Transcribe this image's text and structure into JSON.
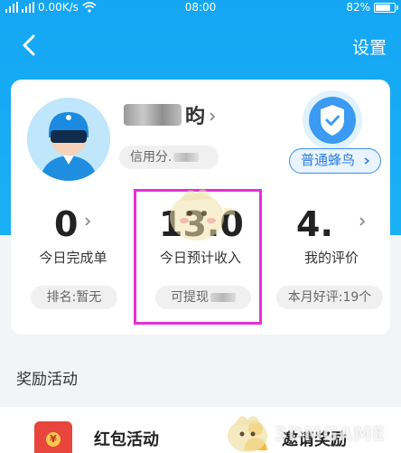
{
  "status_bar": {
    "speed": "0.00K/s",
    "time": "08:00",
    "battery": "82%",
    "battery_level": 0.82
  },
  "nav": {
    "settings": "设置"
  },
  "profile": {
    "name_suffix": "昀",
    "credit_label": "信用分.",
    "level": "普通蜂鸟"
  },
  "stats": [
    {
      "value": "0",
      "label": "今日完成单",
      "pill": "排名:暂无"
    },
    {
      "value": "13.0",
      "label": "今日预计收入",
      "pill": "可提现"
    },
    {
      "value": "4.",
      "label": "我的评价",
      "pill": "本月好评:19个"
    }
  ],
  "section": {
    "title": "奖励活动"
  },
  "activities": [
    {
      "label": "红包活动",
      "icon": "red-packet-icon"
    },
    {
      "label": "邀请奖励",
      "icon": "invite-reward-icon"
    }
  ],
  "colors": {
    "header": "#14a6f3",
    "highlight": "#e62fd6",
    "level_blue": "#2f7fdb"
  },
  "watermark": "3DMGAME"
}
